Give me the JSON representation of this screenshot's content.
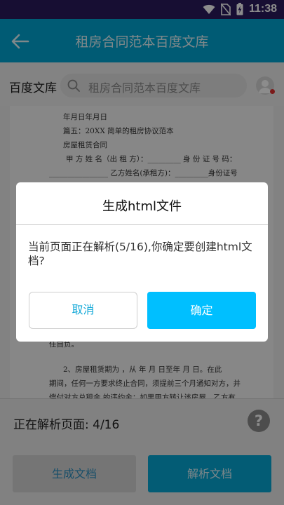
{
  "status_bar": {
    "time": "11:38",
    "icons": [
      "wifi-icon",
      "no-sim-icon",
      "battery-charging-icon"
    ]
  },
  "app_bar": {
    "title": "租房合同范本百度文库",
    "back_icon": "arrow-left-icon"
  },
  "search_row": {
    "brand": "百度文库",
    "search_text": "租房合同范本百度文库",
    "search_icon": "search-icon",
    "avatar_icon": "avatar-icon"
  },
  "document": {
    "lines": [
      "年月日年月日",
      "篇五：20XX 简单的租房协议范本",
      "房屋租赁合同",
      "甲 方 姓 名（出 租 方）：_________ 身 份 证 号 码：",
      "________________ 乙方姓名(承租方)：_________身份证号",
      "",
      "",
      "",
      "",
      "",
      "",
      "",
      "",
      "任自负。",
      "2、房屋租赁期为  ，从 年 月 日至年 月 日。在此",
      "期间，任何一方要求终止合同，须提前三个月通知对方，并",
      "偿付对方总租金  的违约金；如果甲方转让该房屋，乙方有"
    ]
  },
  "bottom_panel": {
    "parse_status": "正在解析页面: 4/16",
    "help_icon": "help-icon",
    "generate_label": "生成文档",
    "parse_label": "解析文档"
  },
  "dialog": {
    "title": "生成html文件",
    "message": "当前页面正在解析(5/16),你确定要创建html文档?",
    "cancel_label": "取消",
    "confirm_label": "确定"
  },
  "colors": {
    "status_bar": "#2a1a5e",
    "app_bar": "#01a6d4",
    "accent": "#00bfff",
    "overlay": "rgba(0,0,0,0.45)"
  }
}
